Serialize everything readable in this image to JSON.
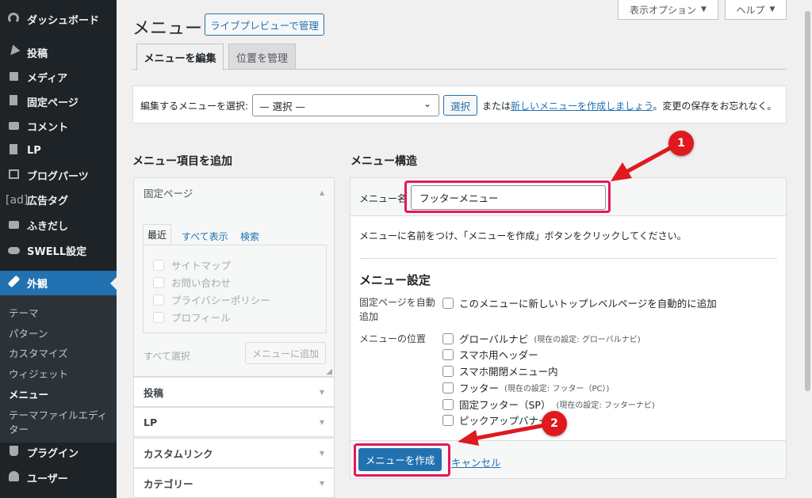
{
  "sidebar": {
    "items": [
      {
        "label": "ダッシュボード",
        "icon": "dashboard-icon"
      },
      {
        "label": "投稿",
        "icon": "pin-icon"
      },
      {
        "label": "メディア",
        "icon": "media-icon"
      },
      {
        "label": "固定ページ",
        "icon": "page-icon"
      },
      {
        "label": "コメント",
        "icon": "comment-icon"
      },
      {
        "label": "LP",
        "icon": "document-icon"
      },
      {
        "label": "ブログパーツ",
        "icon": "grid-icon"
      },
      {
        "label": "広告タグ",
        "icon": "ad-icon",
        "icon_text": "[ad]"
      },
      {
        "label": "ふきだし",
        "icon": "speech-icon"
      },
      {
        "label": "SWELL設定",
        "icon": "swell-icon"
      },
      {
        "label": "外観",
        "icon": "brush-icon"
      },
      {
        "label": "プラグイン",
        "icon": "plugin-icon"
      },
      {
        "label": "ユーザー",
        "icon": "user-icon"
      }
    ],
    "submenu": [
      "テーマ",
      "パターン",
      "カスタマイズ",
      "ウィジェット",
      "メニュー",
      "テーマファイルエディ",
      "ター"
    ]
  },
  "header": {
    "title": "メニュー",
    "live_preview_button": "ライブプレビューで管理",
    "screen_options": "表示オプション",
    "help": "ヘルプ",
    "tabs": [
      "メニューを編集",
      "位置を管理"
    ]
  },
  "select_bar": {
    "label": "編集するメニューを選択:",
    "select_value": "— 選択 —",
    "select_button": "選択",
    "or_text": "または",
    "create_link": "新しいメニューを作成しましょう",
    "after_text": "。変更の保存をお忘れなく。"
  },
  "left": {
    "heading": "メニュー項目を追加",
    "open_section": "固定ページ",
    "inner_tabs": [
      "最近",
      "すべて表示",
      "検索"
    ],
    "pages": [
      "サイトマップ",
      "お問い合わせ",
      "プライバシーポリシー",
      "プロフィール"
    ],
    "select_all": "すべて選択",
    "add_button": "メニューに追加",
    "sections": [
      "投稿",
      "LP",
      "カスタムリンク",
      "カテゴリー"
    ]
  },
  "right": {
    "heading": "メニュー構造",
    "name_label": "メニュー名",
    "name_value": "フッターメニュー",
    "instruction": "メニューに名前をつけ、「メニューを作成」ボタンをクリックしてください。",
    "settings_heading": "メニュー設定",
    "auto_add_label_1": "固定ページを自動",
    "auto_add_label_2": "追加",
    "auto_add_text": "このメニューに新しいトップレベルページを自動的に追加",
    "location_label": "メニューの位置",
    "locations": [
      {
        "label": "グローバルナビ",
        "note": "(現在の設定: グローバルナビ)"
      },
      {
        "label": "スマホ用ヘッダー",
        "note": ""
      },
      {
        "label": "スマホ開閉メニュー内",
        "note": ""
      },
      {
        "label": "フッター",
        "note": "(現在の設定: フッター（PC）)"
      },
      {
        "label": "固定フッター（SP）",
        "note": "(現在の設定: フッターナビ)"
      },
      {
        "label": "ピックアップバナー",
        "note": ""
      }
    ],
    "create_button": "メニューを作成",
    "cancel_link": "キャンセル"
  },
  "annotations": {
    "badge1": "1",
    "badge2": "2",
    "color": "#e0191f",
    "highlight": "#e2185d"
  },
  "colors": {
    "sidebar_bg": "#1d2327",
    "accent": "#2271b1",
    "page_bg": "#f0f0f1"
  }
}
